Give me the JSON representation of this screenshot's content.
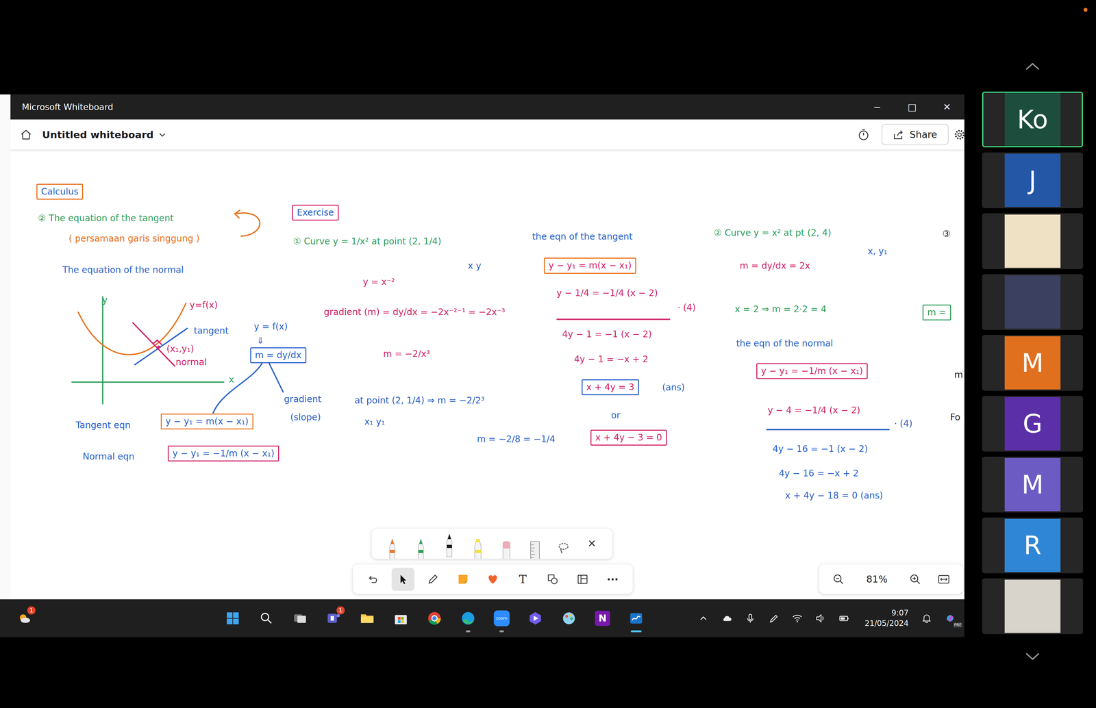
{
  "window": {
    "title": "Microsoft Whiteboard",
    "controls": [
      "−",
      "□",
      "✕"
    ]
  },
  "header": {
    "board_name": "Untitled whiteboard",
    "share": "Share"
  },
  "canvas": {
    "notes": [
      {
        "text": "Calculus",
        "color": "#2a62c9",
        "box": "#e8711c"
      },
      {
        "text": "② The equation of the tangent",
        "color": "#2e9e5a",
        "box": null
      },
      {
        "text": "( persamaan garis singgung )",
        "color": "#e8711c",
        "box": null
      },
      {
        "text": "The equation of the normal",
        "color": "#2a62c9",
        "box": null
      },
      {
        "text": "y",
        "color": "#2e9e5a",
        "box": null
      },
      {
        "text": "y=f(x)",
        "color": "#d0246a",
        "box": null
      },
      {
        "text": "tangent",
        "color": "#2a62c9",
        "box": null
      },
      {
        "text": "(x₁,y₁)",
        "color": "#d0246a",
        "box": null
      },
      {
        "text": "normal",
        "color": "#d0246a",
        "box": null
      },
      {
        "text": "x",
        "color": "#2e9e5a",
        "box": null
      },
      {
        "text": "y = f(x)",
        "color": "#2a62c9",
        "box": null
      },
      {
        "text": "⇓",
        "color": "#2a62c9",
        "box": null
      },
      {
        "text": "m = dy/dx",
        "color": "#2a62c9",
        "box": "#2a62c9"
      },
      {
        "text": "gradient",
        "color": "#2a62c9",
        "box": null
      },
      {
        "text": "(slope)",
        "color": "#2a62c9",
        "box": null
      },
      {
        "text": "Tangent eqn",
        "color": "#2a62c9",
        "box": null
      },
      {
        "text": "y − y₁ = m(x − x₁)",
        "color": "#2a62c9",
        "box": "#e8711c"
      },
      {
        "text": "Normal eqn",
        "color": "#2a62c9",
        "box": null
      },
      {
        "text": "y − y₁ = −1/m (x − x₁)",
        "color": "#2a62c9",
        "box": "#d0246a"
      },
      {
        "text": "Exercise",
        "color": "#2a62c9",
        "box": "#d0246a"
      },
      {
        "text": "① Curve y = 1/x² at point (2, 1/4)",
        "color": "#2e9e5a",
        "box": null
      },
      {
        "text": "x   y",
        "color": "#2a62c9",
        "box": null
      },
      {
        "text": "y = x⁻²",
        "color": "#d0246a",
        "box": null
      },
      {
        "text": "gradient (m) = dy/dx = −2x⁻²⁻¹ = −2x⁻³",
        "color": "#d0246a",
        "box": null
      },
      {
        "text": "m = −2/x³",
        "color": "#d0246a",
        "box": null
      },
      {
        "text": "at point (2, 1/4) ⇒ m = −2/2³",
        "color": "#2a62c9",
        "box": null
      },
      {
        "text": "x₁ y₁",
        "color": "#2a62c9",
        "box": null
      },
      {
        "text": "m = −2/8 = −1/4",
        "color": "#2a62c9",
        "box": null
      },
      {
        "text": "the eqn of the tangent",
        "color": "#2a62c9",
        "box": null
      },
      {
        "text": "y − y₁ = m(x − x₁)",
        "color": "#d0246a",
        "box": "#e8711c"
      },
      {
        "text": "y − 1/4 = −1/4 (x − 2)",
        "color": "#d0246a",
        "box": null
      },
      {
        "text": "· (4)",
        "color": "#d0246a",
        "box": null
      },
      {
        "text": "4y − 1 = −1 (x − 2)",
        "color": "#d0246a",
        "box": null
      },
      {
        "text": "4y − 1 = −x + 2",
        "color": "#d0246a",
        "box": null
      },
      {
        "text": "x + 4y = 3",
        "color": "#d0246a",
        "box": "#2a62c9"
      },
      {
        "text": "(ans)",
        "color": "#2a62c9",
        "box": null
      },
      {
        "text": "or",
        "color": "#2a62c9",
        "box": null
      },
      {
        "text": "x + 4y − 3 = 0",
        "color": "#d0246a",
        "box": "#d0246a"
      },
      {
        "text": "② Curve y = x² at pt (2, 4)",
        "color": "#2e9e5a",
        "box": null
      },
      {
        "text": "x, y₁",
        "color": "#2a62c9",
        "box": null
      },
      {
        "text": "m = dy/dx = 2x",
        "color": "#d0246a",
        "box": null
      },
      {
        "text": "x = 2 ⇒ m = 2·2 = 4",
        "color": "#2e9e5a",
        "box": null
      },
      {
        "text": "the eqn of the normal",
        "color": "#2a62c9",
        "box": null
      },
      {
        "text": "y − y₁ = −1/m (x − x₁)",
        "color": "#d0246a",
        "box": "#d0246a"
      },
      {
        "text": "y − 4 = −1/4 (x − 2)",
        "color": "#d0246a",
        "box": null
      },
      {
        "text": "· (4)",
        "color": "#2a62c9",
        "box": null
      },
      {
        "text": "4y − 16 = −1 (x − 2)",
        "color": "#2a62c9",
        "box": null
      },
      {
        "text": "4y − 16 = −x + 2",
        "color": "#2a62c9",
        "box": null
      },
      {
        "text": "x + 4y − 18 = 0 (ans)",
        "color": "#2a62c9",
        "box": null
      },
      {
        "text": "③",
        "color": "#222222",
        "box": null
      },
      {
        "text": "m =",
        "color": "#2e9e5a",
        "box": "#2e9e5a"
      },
      {
        "text": "m",
        "color": "#222222",
        "box": null
      },
      {
        "text": "Fo",
        "color": "#222222",
        "box": null
      }
    ]
  },
  "pen_tray": {
    "tools": [
      {
        "kind": "pen",
        "color": "#e8742c",
        "selected": false
      },
      {
        "kind": "pen",
        "color": "#2e9e5a",
        "selected": false
      },
      {
        "kind": "pen",
        "color": "#1a1a1a",
        "selected": true
      },
      {
        "kind": "highlighter",
        "color": "#f3df3c",
        "selected": false
      },
      {
        "kind": "eraser",
        "color": "#f2a9b8",
        "selected": false
      },
      {
        "kind": "ruler",
        "color": "#9a9a9a",
        "selected": false
      },
      {
        "kind": "lasso",
        "color": "#444444",
        "selected": false
      }
    ],
    "close": "✕"
  },
  "toolbar": {
    "tools": [
      {
        "kind": "undo",
        "selected": false
      },
      {
        "kind": "select",
        "selected": true
      },
      {
        "kind": "ink",
        "selected": false
      },
      {
        "kind": "note",
        "selected": false
      },
      {
        "kind": "reaction",
        "selected": false
      },
      {
        "kind": "text",
        "selected": false
      },
      {
        "kind": "shapes",
        "selected": false
      },
      {
        "kind": "templates",
        "selected": false
      },
      {
        "kind": "more",
        "selected": false
      }
    ],
    "text_label": "T",
    "more_label": "···"
  },
  "zoom": {
    "value": "81%"
  },
  "taskbar": {
    "weather": {
      "badge": "1"
    },
    "apps": [
      {
        "kind": "windows",
        "label": null,
        "badge": null,
        "running": false,
        "active": false
      },
      {
        "kind": "search",
        "label": null,
        "badge": null,
        "running": false,
        "active": false
      },
      {
        "kind": "taskview",
        "label": null,
        "badge": null,
        "running": false,
        "active": false
      },
      {
        "kind": "teams",
        "label": null,
        "badge": "1",
        "running": false,
        "active": false
      },
      {
        "kind": "explorer",
        "label": null,
        "badge": null,
        "running": false,
        "active": false
      },
      {
        "kind": "store",
        "label": null,
        "badge": null,
        "running": false,
        "active": false
      },
      {
        "kind": "chrome",
        "label": null,
        "badge": null,
        "running": false,
        "active": false
      },
      {
        "kind": "edge",
        "label": null,
        "badge": null,
        "running": true,
        "active": false
      },
      {
        "kind": "zoom",
        "label": "zoom",
        "badge": null,
        "running": true,
        "active": false
      },
      {
        "kind": "video",
        "label": null,
        "badge": null,
        "running": false,
        "active": false
      },
      {
        "kind": "paint",
        "label": null,
        "badge": null,
        "running": false,
        "active": false
      },
      {
        "kind": "onenote",
        "label": "N",
        "badge": null,
        "running": false,
        "active": false
      },
      {
        "kind": "whiteboard",
        "label": null,
        "badge": null,
        "running": true,
        "active": true
      }
    ],
    "tray": [
      {
        "kind": "chevron",
        "label": null
      },
      {
        "kind": "cloud",
        "label": null
      },
      {
        "kind": "mic",
        "label": null
      },
      {
        "kind": "pen",
        "label": null
      },
      {
        "kind": "wifi",
        "label": null
      },
      {
        "kind": "volume",
        "label": null
      },
      {
        "kind": "battery",
        "label": null
      }
    ],
    "clock": {
      "time": "9:07",
      "date": "21/05/2024"
    },
    "tray_after": [
      {
        "kind": "bell",
        "label": null
      },
      {
        "kind": "copilot",
        "label": "PRE"
      }
    ]
  },
  "participants": [
    {
      "kind": "initials",
      "initials": "Ko",
      "color": "#1d4d3c",
      "speaking": true
    },
    {
      "kind": "initials",
      "initials": "J",
      "color": "#2557a7",
      "speaking": false
    },
    {
      "kind": "picture",
      "color": "#efe1c4",
      "speaking": false
    },
    {
      "kind": "picture",
      "color": "#3b4060",
      "speaking": false
    },
    {
      "kind": "initials",
      "initials": "M",
      "color": "#e0701e",
      "speaking": false
    },
    {
      "kind": "initials",
      "initials": "G",
      "color": "#5b2fa8",
      "speaking": false
    },
    {
      "kind": "initials",
      "initials": "M",
      "color": "#6d5bc4",
      "speaking": false
    },
    {
      "kind": "initials",
      "initials": "R",
      "color": "#2f86d6",
      "speaking": false
    },
    {
      "kind": "picture",
      "color": "#d8d3cb",
      "speaking": false
    }
  ],
  "recording": true
}
